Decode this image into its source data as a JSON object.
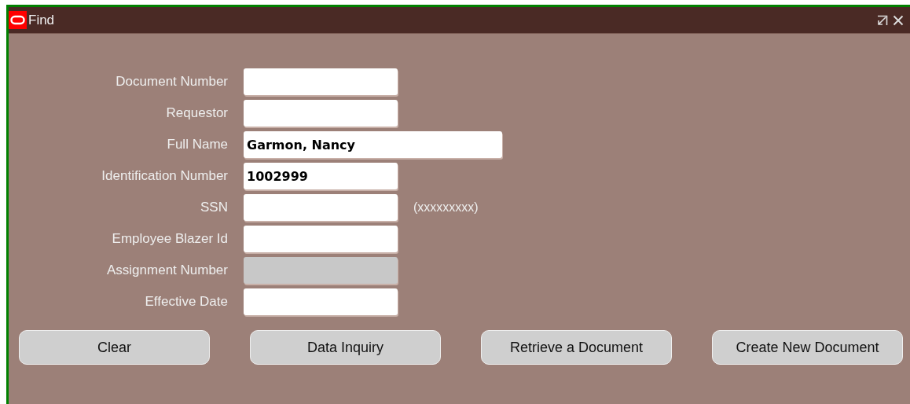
{
  "window": {
    "title": "Find"
  },
  "fields": [
    {
      "label": "Document Number",
      "disabled": false,
      "wide": false
    },
    {
      "label": "Requestor",
      "disabled": false,
      "wide": false
    },
    {
      "label": "Full Name",
      "value": "Garmon, Nancy",
      "disabled": false,
      "wide": true
    },
    {
      "label": "Identification Number",
      "value": "1002999",
      "disabled": false,
      "wide": false
    },
    {
      "label": "SSN",
      "disabled": false,
      "wide": false,
      "hint": "(xxxxxxxxx)"
    },
    {
      "label": "Employee Blazer Id",
      "disabled": false,
      "wide": false
    },
    {
      "label": "Assignment Number",
      "disabled": true,
      "wide": false
    },
    {
      "label": "Effective Date",
      "disabled": false,
      "wide": false
    }
  ],
  "buttons": [
    "Clear",
    "Data Inquiry",
    "Retrieve a Document",
    "Create New Document"
  ]
}
